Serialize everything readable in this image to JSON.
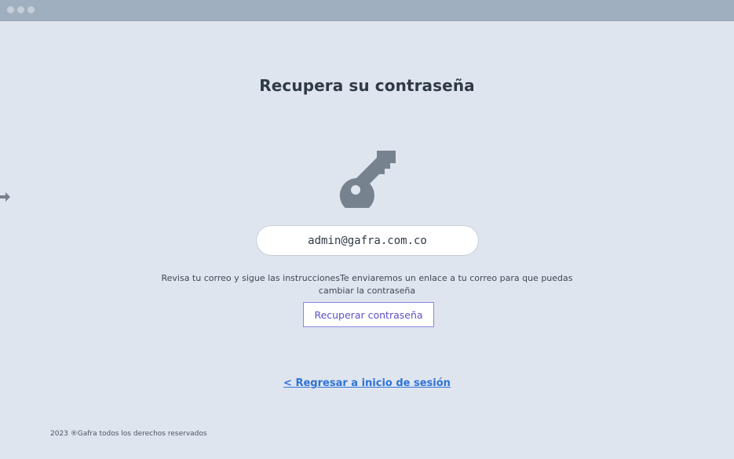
{
  "window": {
    "dots": [
      "window-dot-close",
      "window-dot-minimize",
      "window-dot-maximize"
    ]
  },
  "page": {
    "title": "Recupera su contraseña",
    "key_icon": "key-icon",
    "side_icon": "arrow-right-icon"
  },
  "form": {
    "email_value": "admin@gafra.com.co",
    "instructions": "Revisa tu correo y sigue las instruccionesTe enviaremos un enlace a tu correo para que puedas cambiar la contraseña",
    "recover_button_label": "Recuperar contraseña",
    "back_link_label": "< Regresar a inicio de sesión"
  },
  "footer": {
    "text": "2023 ®Gafra todos los derechos reservados"
  },
  "colors": {
    "background": "#dfe5ee",
    "titlebar": "#a0afbf",
    "icon": "#77828f",
    "accent": "#5a51c8",
    "link": "#2e73d9"
  }
}
